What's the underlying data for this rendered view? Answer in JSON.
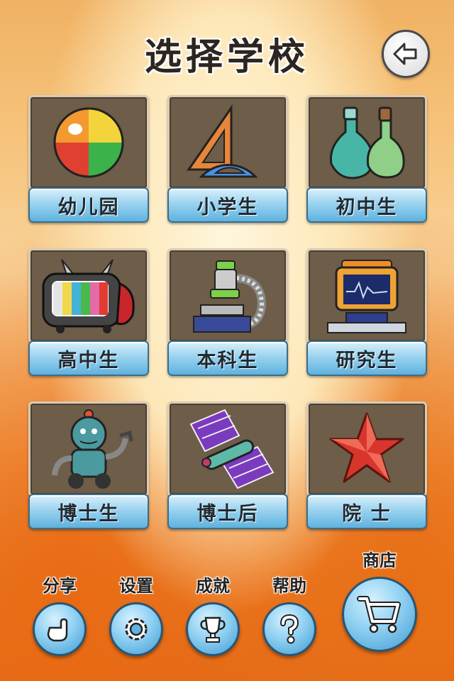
{
  "header": {
    "title": "选择学校"
  },
  "schools": [
    {
      "label": "幼儿园",
      "icon": "beach-ball-icon"
    },
    {
      "label": "小学生",
      "icon": "ruler-protractor-icon"
    },
    {
      "label": "初中生",
      "icon": "flasks-icon"
    },
    {
      "label": "高中生",
      "icon": "television-icon"
    },
    {
      "label": "本科生",
      "icon": "microscope-icon"
    },
    {
      "label": "研究生",
      "icon": "computer-icon"
    },
    {
      "label": "博士生",
      "icon": "robot-icon"
    },
    {
      "label": "博士后",
      "icon": "satellite-icon"
    },
    {
      "label": "院 士",
      "icon": "red-star-icon"
    }
  ],
  "bottom": {
    "share": "分享",
    "settings": "设置",
    "achievements": "成就",
    "help": "帮助",
    "shop": "商店"
  }
}
